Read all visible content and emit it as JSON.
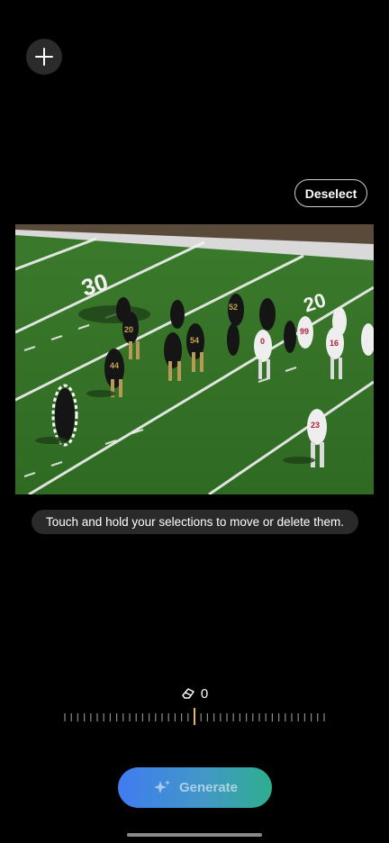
{
  "toolbar": {
    "add_icon": "plus-icon",
    "deselect_label": "Deselect"
  },
  "photo": {
    "description_icon": "football-field-photo",
    "jersey_numbers": [
      "30",
      "52",
      "20",
      "44",
      "54",
      "0",
      "99",
      "16",
      "23"
    ],
    "field_number": "30"
  },
  "hint": {
    "text": "Touch and hold your selections to move or delete them."
  },
  "eraser": {
    "icon": "eraser-icon",
    "value": "0"
  },
  "generate": {
    "icon": "sparkle-icon",
    "label": "Generate"
  },
  "colors": {
    "background": "#000000",
    "pill": "#2a2a2a",
    "slider_indicator": "#e6b94a",
    "generate_gradient": [
      "#3f7cf0",
      "#2fae8d"
    ]
  }
}
